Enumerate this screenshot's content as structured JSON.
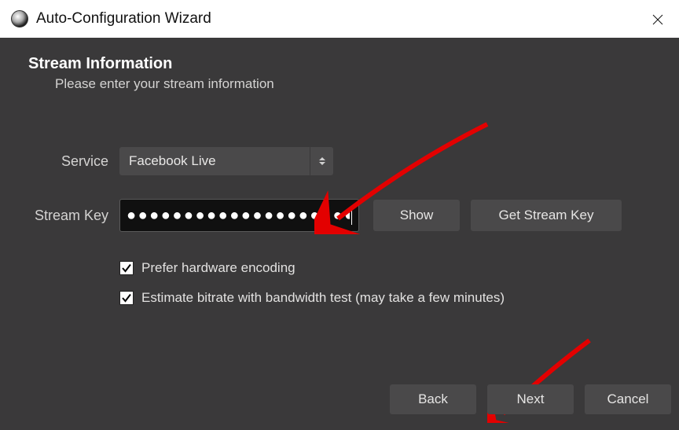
{
  "window": {
    "title": "Auto-Configuration Wizard"
  },
  "header": {
    "title": "Stream Information",
    "subtitle": "Please enter your stream information"
  },
  "form": {
    "service_label": "Service",
    "service_value": "Facebook Live",
    "streamkey_label": "Stream Key",
    "streamkey_mask": "●●●●●●●●●●●●●●●●●●●●●●●●",
    "show_button": "Show",
    "getkey_button": "Get Stream Key",
    "prefer_hw": "Prefer hardware encoding",
    "prefer_hw_checked": true,
    "estimate_bitrate": "Estimate bitrate with bandwidth test (may take a few minutes)",
    "estimate_bitrate_checked": true
  },
  "footer": {
    "back": "Back",
    "next": "Next",
    "cancel": "Cancel"
  },
  "annotation": {
    "arrow_color": "#e30000"
  }
}
